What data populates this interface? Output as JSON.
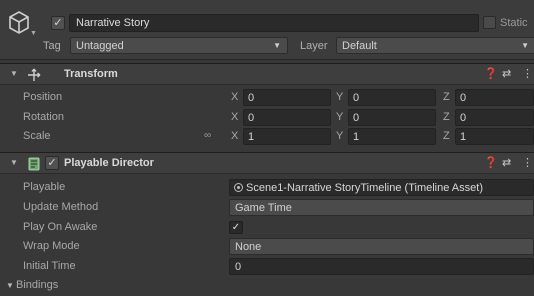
{
  "gameobject": {
    "active_checkmark": "✓",
    "name": "Narrative Story",
    "static_label": "Static",
    "tag_label": "Tag",
    "tag_value": "Untagged",
    "layer_label": "Layer",
    "layer_value": "Default"
  },
  "transform": {
    "title": "Transform",
    "rows": [
      {
        "label": "Position",
        "x": "0",
        "y": "0",
        "z": "0"
      },
      {
        "label": "Rotation",
        "x": "0",
        "y": "0",
        "z": "0"
      },
      {
        "label": "Scale",
        "x": "1",
        "y": "1",
        "z": "1"
      }
    ],
    "axes": {
      "x": "X",
      "y": "Y",
      "z": "Z"
    }
  },
  "playable_director": {
    "title": "Playable Director",
    "enabled_checkmark": "✓",
    "playable_label": "Playable",
    "playable_value": "Scene1-Narrative StoryTimeline (Timeline Asset)",
    "update_method_label": "Update Method",
    "update_method_value": "Game Time",
    "play_on_awake_label": "Play On Awake",
    "play_on_awake_checkmark": "✓",
    "wrap_mode_label": "Wrap Mode",
    "wrap_mode_value": "None",
    "initial_time_label": "Initial Time",
    "initial_time_value": "0",
    "bindings_label": "Bindings"
  },
  "icons": {
    "gameobject": "cube-icon",
    "transform": "move-arrows-icon",
    "playable_director": "director-icon",
    "help": "help-icon",
    "presets": "presets-icon",
    "context_menu": "kebab-menu-icon",
    "scale_link": "link-icon",
    "object_picker": "object-picker-icon"
  },
  "colors": {
    "background": "#383838",
    "field_dark": "#2a2a2a",
    "dropdown": "#4b4b4b",
    "text": "#d2d2d2"
  }
}
